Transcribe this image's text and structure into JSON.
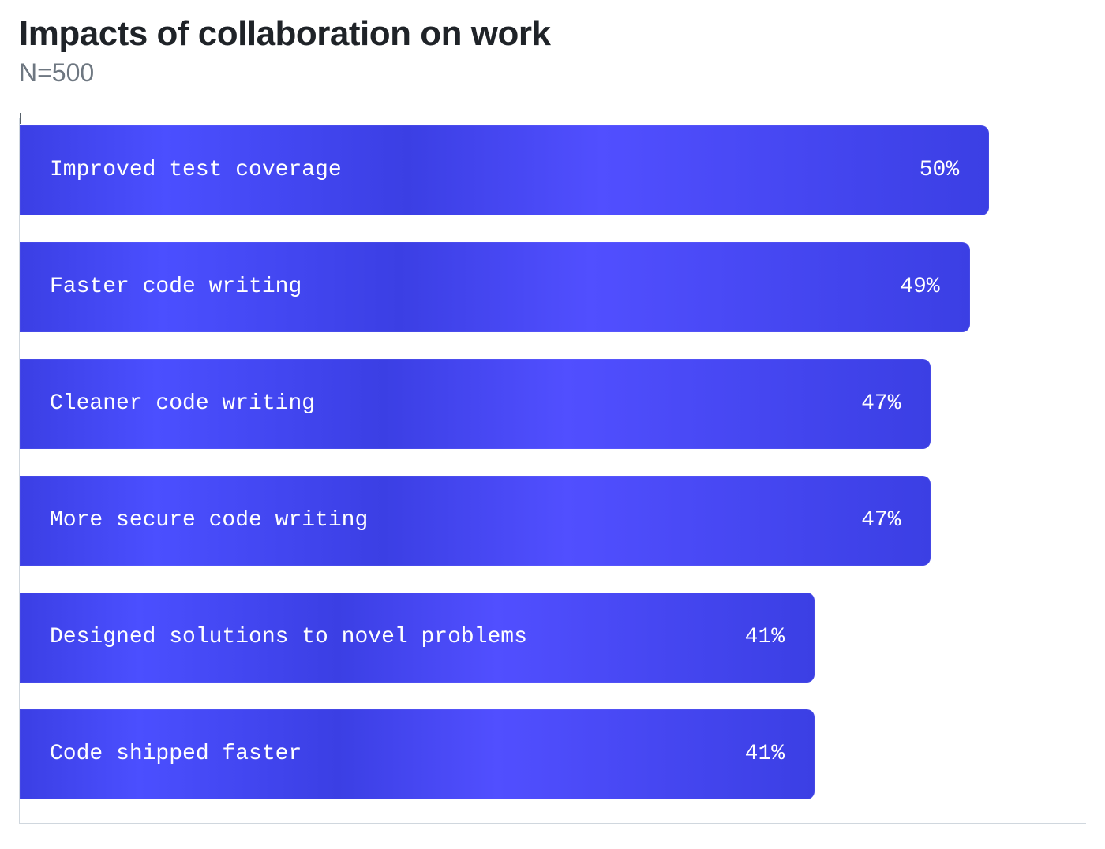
{
  "header": {
    "title": "Impacts of collaboration on work",
    "subtitle": "N=500"
  },
  "chart_data": {
    "type": "bar",
    "orientation": "horizontal",
    "title": "Impacts of collaboration on work",
    "subtitle": "N=500",
    "categories": [
      "Improved test coverage",
      "Faster code writing",
      "Cleaner code writing",
      "More secure code writing",
      "Designed solutions to novel problems",
      "Code shipped faster"
    ],
    "values": [
      50,
      49,
      47,
      47,
      41,
      41
    ],
    "value_suffix": "%",
    "xlabel": "",
    "ylabel": "",
    "xlim": [
      0,
      55
    ],
    "bar_color": "#3b3fe4",
    "label_color": "#ffffff"
  }
}
